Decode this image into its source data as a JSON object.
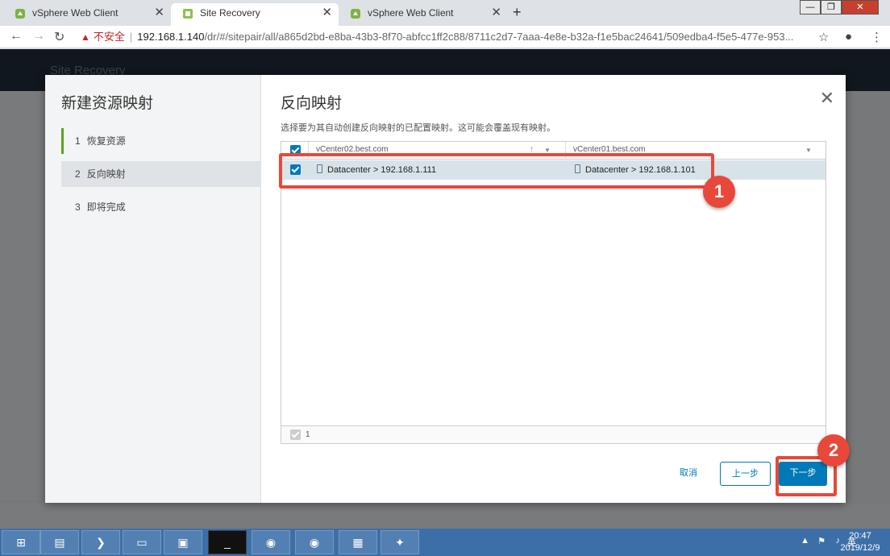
{
  "browser": {
    "tabs": [
      {
        "label": "vSphere Web Client",
        "active": false
      },
      {
        "label": "Site Recovery",
        "active": true
      },
      {
        "label": "vSphere Web Client",
        "active": false
      }
    ],
    "insecure_label": "不安全",
    "url_host": "192.168.1.140",
    "url_path": "/dr/#/sitepair/all/a865d2bd-e8ba-43b3-8f70-abfcc1ff2c88/8711c2d7-7aaa-4e8e-b32a-f1e5bac24641/509edba4-f5e5-477e-953..."
  },
  "wizard": {
    "title": "新建资源映射",
    "steps": [
      {
        "num": "1",
        "label": "恢复资源"
      },
      {
        "num": "2",
        "label": "反向映射"
      },
      {
        "num": "3",
        "label": "即将完成"
      }
    ]
  },
  "page": {
    "heading": "反向映射",
    "description": "选择要为其自动创建反向映射的已配置映射。这可能会覆盖现有映射。",
    "columns": [
      "vCenter02.best.com",
      "vCenter01.best.com"
    ],
    "rows": [
      {
        "source": "Datacenter > 192.168.1.111",
        "target": "Datacenter > 192.168.1.101",
        "checked": true
      }
    ],
    "footer_count": "1"
  },
  "buttons": {
    "cancel": "取消",
    "prev": "上一步",
    "next": "下一步"
  },
  "annotations": {
    "badge1": "1",
    "badge2": "2",
    "color": "#e8483a"
  },
  "taskbar": {
    "time": "20:47",
    "date": "2019/12/9",
    "ime": "英"
  },
  "theme": {
    "accent": "#0079b8",
    "step_done": "#5aa220"
  }
}
